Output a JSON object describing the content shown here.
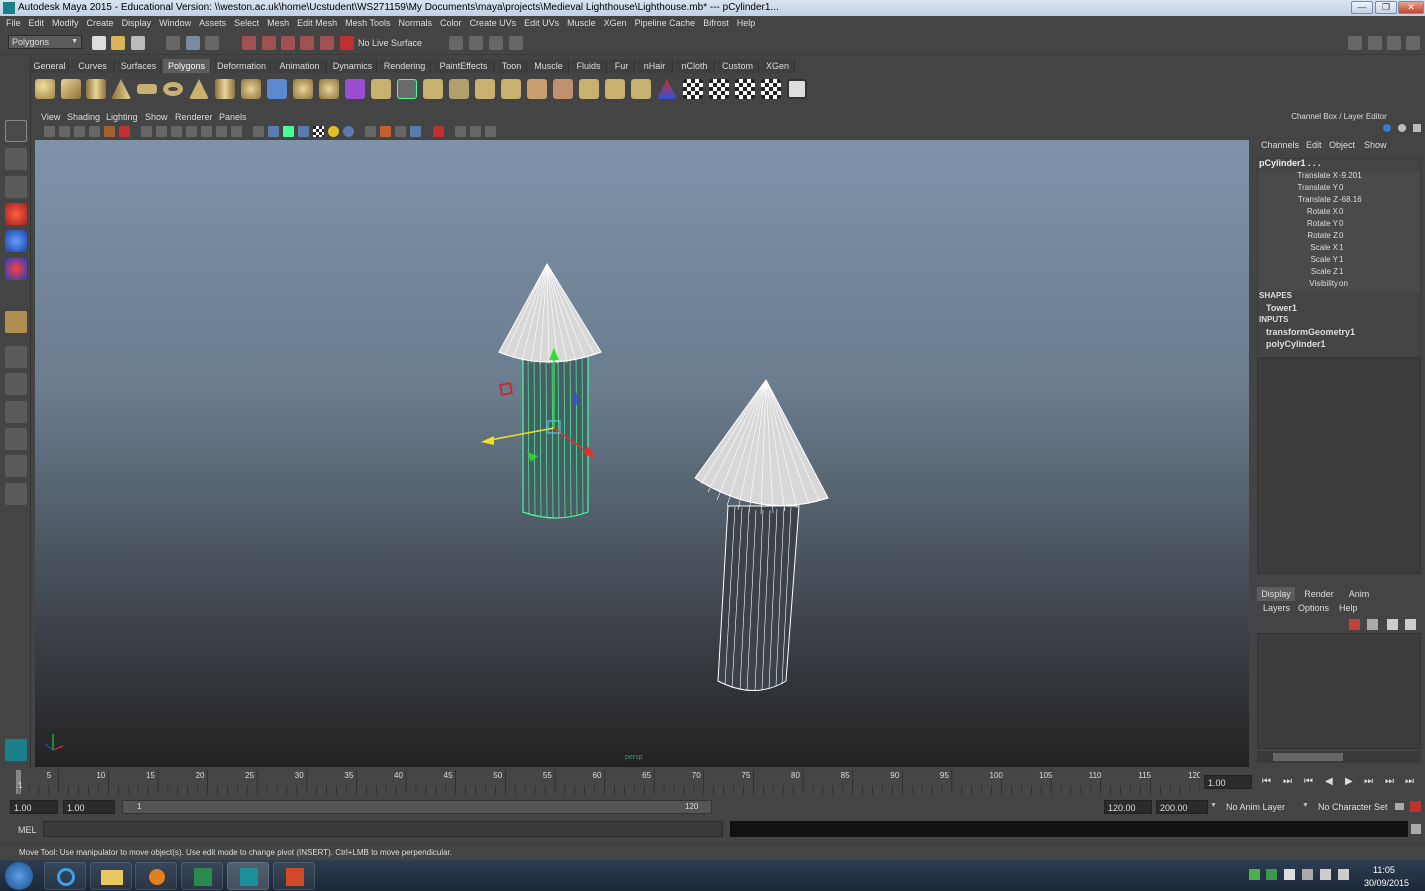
{
  "window": {
    "title": "Autodesk Maya 2015 - Educational Version: \\\\weston.ac.uk\\home\\Ucstudent\\WS271159\\My Documents\\maya\\projects\\Medieval Lighthouse\\Lighthouse.mb*  ---   pCylinder1...",
    "minimize": "—",
    "maximize": "❐",
    "close": "✕"
  },
  "menubar": [
    "File",
    "Edit",
    "Modify",
    "Create",
    "Display",
    "Window",
    "Assets",
    "Select",
    "Mesh",
    "Edit Mesh",
    "Mesh Tools",
    "Normals",
    "Color",
    "Create UVs",
    "Edit UVs",
    "Muscle",
    "XGen",
    "Pipeline Cache",
    "Bifrost",
    "Help"
  ],
  "statusline": {
    "mode": "Polygons",
    "live_surface": "No Live Surface"
  },
  "shelf_tabs": [
    "General",
    "Curves",
    "Surfaces",
    "Polygons",
    "Deformation",
    "Animation",
    "Dynamics",
    "Rendering",
    "PaintEffects",
    "Toon",
    "Muscle",
    "Fluids",
    "Fur",
    "nHair",
    "nCloth",
    "Custom",
    "XGen"
  ],
  "shelf_active": "Polygons",
  "viewport": {
    "menu": [
      "View",
      "Shading",
      "Lighting",
      "Show",
      "Renderer",
      "Panels"
    ],
    "camera_label": "persp"
  },
  "channelbox": {
    "header": "Channel Box / Layer Editor",
    "menu": [
      "Channels",
      "Edit",
      "Object",
      "Show"
    ],
    "object": "pCylinder1 . . .",
    "attributes": [
      {
        "name": "Translate X",
        "value": "-9.201"
      },
      {
        "name": "Translate Y",
        "value": "0"
      },
      {
        "name": "Translate Z",
        "value": "-68.16"
      },
      {
        "name": "Rotate X",
        "value": "0"
      },
      {
        "name": "Rotate Y",
        "value": "0"
      },
      {
        "name": "Rotate Z",
        "value": "0"
      },
      {
        "name": "Scale X",
        "value": "1"
      },
      {
        "name": "Scale Y",
        "value": "1"
      },
      {
        "name": "Scale Z",
        "value": "1"
      },
      {
        "name": "Visibility",
        "value": "on"
      }
    ],
    "shapes_label": "SHAPES",
    "shape": "Tower1",
    "inputs_label": "INPUTS",
    "inputs": [
      "transformGeometry1",
      "polyCylinder1"
    ]
  },
  "layereditor": {
    "tabs": [
      "Display",
      "Render",
      "Anim"
    ],
    "active_tab": "Display",
    "menu": [
      "Layers",
      "Options",
      "Help"
    ]
  },
  "timeslider": {
    "ticks": [
      "5",
      "10",
      "15",
      "20",
      "25",
      "30",
      "35",
      "40",
      "45",
      "50",
      "55",
      "60",
      "65",
      "70",
      "75",
      "80",
      "85",
      "90",
      "95",
      "100",
      "105",
      "110",
      "115",
      "120"
    ],
    "first_frame": "1",
    "current_frame": "1.00"
  },
  "rangeslider": {
    "start_time": "1.00",
    "playback_start": "1.00",
    "range_start_label": "1",
    "range_end_label": "120",
    "playback_end": "120.00",
    "end_time": "200.00",
    "anim_layer": "No Anim Layer",
    "character_set": "No Character Set"
  },
  "cmdline": {
    "label": "MEL"
  },
  "helpline": {
    "text": "Move Tool: Use manipulator to move object(s). Use edit mode to change pivot (INSERT).  Ctrl+LMB to move perpendicular."
  },
  "taskbar": {
    "time": "11:05",
    "date": "30/09/2015"
  },
  "colors": {
    "selection_green": "#46ff95",
    "wire_white": "#ffffff",
    "axis_x": "#e03030",
    "axis_y": "#30e030",
    "axis_z": "#3050e0",
    "manip_yellow": "#f0e020"
  }
}
